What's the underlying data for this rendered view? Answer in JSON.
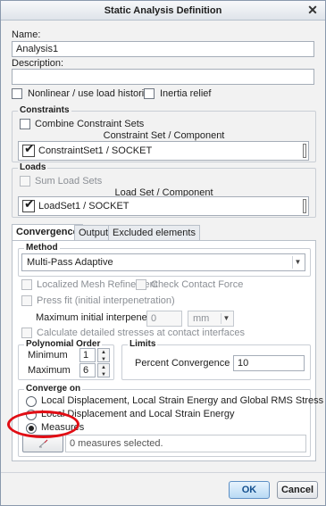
{
  "window": {
    "title": "Static Analysis Definition",
    "close_glyph": "✕"
  },
  "name": {
    "label": "Name:",
    "value": "Analysis1"
  },
  "description": {
    "label": "Description:",
    "value": ""
  },
  "options": {
    "nonlinear": "Nonlinear / use load histories",
    "inertia": "Inertia relief"
  },
  "constraints": {
    "title": "Constraints",
    "combine": "Combine Constraint Sets",
    "header": "Constraint Set / Component",
    "row": "ConstraintSet1 / SOCKET"
  },
  "loads": {
    "title": "Loads",
    "sum": "Sum Load Sets",
    "header": "Load Set / Component",
    "row": "LoadSet1 / SOCKET"
  },
  "tabs": [
    "Convergence",
    "Output",
    "Excluded elements"
  ],
  "method": {
    "title": "Method",
    "value": "Multi-Pass Adaptive"
  },
  "refine": {
    "localized": "Localized Mesh Refinement",
    "contact": "Check Contact Force",
    "pressfit": "Press fit (initial interpenetration)",
    "max_label": "Maximum initial interpenetration",
    "max_value": "0",
    "unit": "mm",
    "detailed": "Calculate detailed stresses at contact interfaces"
  },
  "poly": {
    "title": "Polynomial Order",
    "min_label": "Minimum",
    "min_value": "1",
    "max_label": "Maximum",
    "max_value": "6"
  },
  "limits": {
    "title": "Limits",
    "label": "Percent Convergence",
    "value": "10"
  },
  "converge": {
    "title": "Converge on",
    "opt1": "Local Displacement, Local Strain Energy and Global RMS Stress",
    "opt2": "Local Displacement and Local Strain Energy",
    "opt3": "Measures",
    "selected": "0 measures selected."
  },
  "buttons": {
    "ok": "OK",
    "cancel": "Cancel"
  },
  "colors": {
    "annotation": "#e10d14",
    "ok_accent": "#b8daf4"
  }
}
